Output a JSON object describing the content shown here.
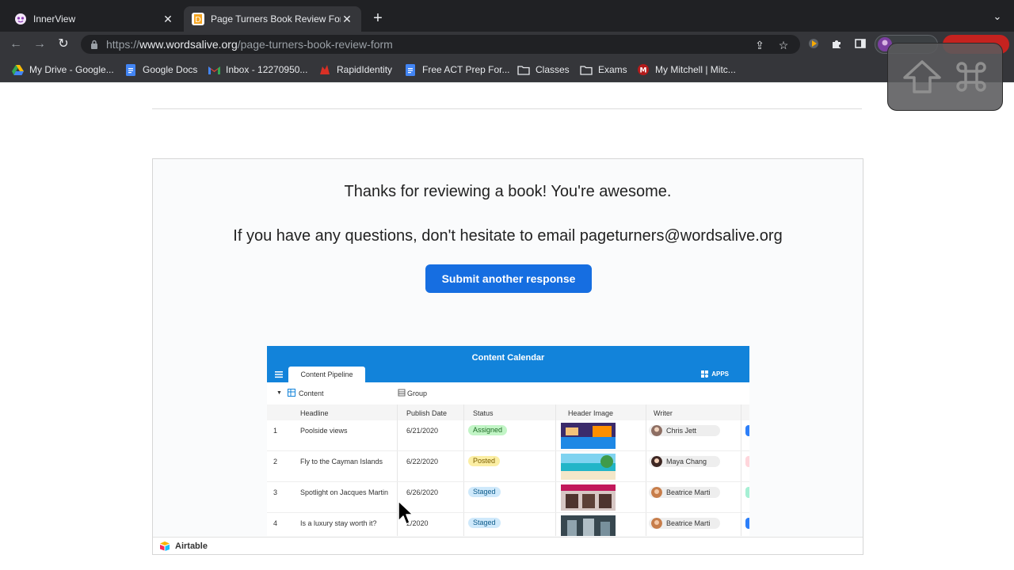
{
  "browser": {
    "tabs": [
      {
        "title": "InnerView",
        "active": false
      },
      {
        "title": "Page Turners Book Review Form",
        "active": true
      }
    ],
    "url": {
      "scheme": "https://",
      "host": "www.wordsalive.org",
      "path": "/page-turners-book-review-form"
    },
    "bookmarks": [
      {
        "label": "My Drive - Google...",
        "icon": "google-drive-icon"
      },
      {
        "label": "Google Docs",
        "icon": "google-docs-icon"
      },
      {
        "label": "Inbox - 12270950...",
        "icon": "gmail-icon"
      },
      {
        "label": "RapidIdentity",
        "icon": "rapididentity-icon"
      },
      {
        "label": "Free ACT Prep For...",
        "icon": "google-docs-icon"
      },
      {
        "label": "Classes",
        "icon": "folder-icon"
      },
      {
        "label": "Exams",
        "icon": "folder-icon"
      },
      {
        "label": "My Mitchell | Mitc...",
        "icon": "mitchell-icon"
      }
    ]
  },
  "form": {
    "thanks": "Thanks for reviewing a book! You're awesome.",
    "questions": "If you have any questions, don't hesitate to email pageturners@wordsalive.org",
    "submit_label": "Submit another response"
  },
  "airtable_preview": {
    "title": "Content Calendar",
    "tab": "Content Pipeline",
    "apps_label": "APPS",
    "view_label": "Content",
    "group_label": "Group",
    "columns": [
      "Headline",
      "Publish Date",
      "Status",
      "Header Image",
      "Writer"
    ],
    "rows": [
      {
        "num": "1",
        "headline": "Poolside views",
        "date": "6/21/2020",
        "status": "Assigned",
        "writer": "Chris Jett"
      },
      {
        "num": "2",
        "headline": "Fly to the Cayman Islands",
        "date": "6/22/2020",
        "status": "Posted",
        "writer": "Maya Chang"
      },
      {
        "num": "3",
        "headline": "Spotlight on Jacques Martin",
        "date": "6/26/2020",
        "status": "Staged",
        "writer": "Beatrice Marti"
      },
      {
        "num": "4",
        "headline": "Is a luxury stay worth it?",
        "date": "2/2020",
        "status": "Staged",
        "writer": "Beatrice Marti"
      }
    ],
    "status_colors": {
      "Assigned": "#c2f5c6",
      "Posted": "#fbeea4",
      "Staged": "#cfe9fb"
    }
  },
  "footer": {
    "brand": "Airtable"
  },
  "colors": {
    "accent": "#166ee1",
    "airtable_header": "#1283da",
    "chrome_dark": "#202124",
    "chrome_toolbar": "#35363a"
  }
}
